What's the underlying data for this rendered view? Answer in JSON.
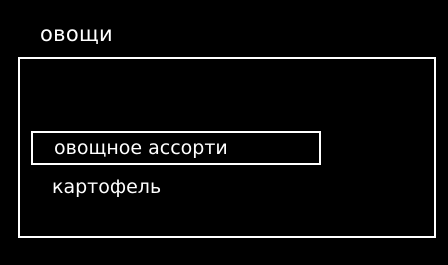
{
  "screen": {
    "title": "овощи"
  },
  "menu": {
    "items": [
      {
        "label": "овощное ассорти",
        "selected": true
      },
      {
        "label": "картофель",
        "selected": false
      }
    ]
  },
  "colors": {
    "background": "#000000",
    "foreground": "#ffffff"
  }
}
